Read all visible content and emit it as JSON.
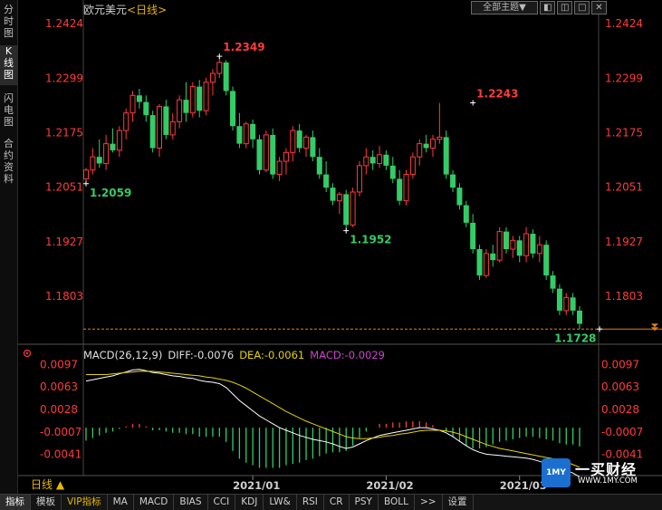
{
  "sidebar": {
    "tabs": [
      {
        "label": "分时图",
        "active": false
      },
      {
        "label": "K线图",
        "active": true
      },
      {
        "label": "闪电图",
        "active": false
      },
      {
        "label": "合约资料",
        "active": false
      }
    ]
  },
  "header": {
    "symbol": "欧元美元",
    "period": "<日线>",
    "view_dropdown": "全部主题▼",
    "buttons": [
      "◧",
      "◫",
      "□",
      "✕"
    ]
  },
  "period_selector": "日线 ▲",
  "macd_legend": {
    "name": "MACD(26,12,9)",
    "diff": "DIFF:-0.0076",
    "dea": "DEA:-0.0061",
    "macd": "MACD:-0.0029"
  },
  "colors": {
    "up": "#ff3b3b",
    "down": "#33cc66",
    "axis_label": "#ff3b3b",
    "diff_line": "#ffffff",
    "dea_line": "#e6d200",
    "macd_text": "#cc44cc"
  },
  "bottom_tabs": [
    {
      "label": "指标",
      "active": true
    },
    {
      "label": "模板"
    },
    {
      "label": "VIP指标",
      "vip": true
    },
    {
      "label": "MA"
    },
    {
      "label": "MACD"
    },
    {
      "label": "BIAS"
    },
    {
      "label": "CCI"
    },
    {
      "label": "KDJ"
    },
    {
      "label": "LW&"
    },
    {
      "label": "RSI"
    },
    {
      "label": "CR"
    },
    {
      "label": "PSY"
    },
    {
      "label": "BOLL"
    },
    {
      "label": ">>"
    },
    {
      "label": "设置"
    }
  ],
  "watermark": {
    "logo": "1MY",
    "name": "一买财经",
    "url": "WWW.1MY.COM"
  },
  "chart_data": [
    {
      "type": "candlestick",
      "ylim": [
        1.171,
        1.244
      ],
      "yticks": [
        1.2424,
        1.2299,
        1.2175,
        1.2051,
        1.1927,
        1.1803
      ],
      "ytick_labels": [
        "1.2424",
        "1.2299",
        "1.2175",
        "1.2051",
        "1.1927",
        "1.1803"
      ],
      "xticks": [
        {
          "index": 25,
          "label": "2021/01"
        },
        {
          "index": 45,
          "label": "2021/02"
        },
        {
          "index": 65,
          "label": "2021/03"
        }
      ],
      "annotations": [
        {
          "index": 20,
          "value": 1.2349,
          "label": "1.2349",
          "side": "high"
        },
        {
          "index": 0,
          "value": 1.2059,
          "label": "1.2059",
          "side": "low"
        },
        {
          "index": 39,
          "value": 1.1952,
          "label": "1.1952",
          "side": "low"
        },
        {
          "index": 58,
          "value": 1.2243,
          "label": "1.2243",
          "side": "high"
        },
        {
          "index": 77,
          "value": 1.1728,
          "label": "1.1728",
          "side": "low"
        }
      ],
      "last_price_line": 1.1728,
      "candles": [
        [
          1.207,
          1.2095,
          1.2059,
          1.209
        ],
        [
          1.209,
          1.214,
          1.208,
          1.212
        ],
        [
          1.212,
          1.216,
          1.2095,
          1.2105
        ],
        [
          1.2105,
          1.217,
          1.209,
          1.215
        ],
        [
          1.215,
          1.2185,
          1.213,
          1.2135
        ],
        [
          1.2135,
          1.219,
          1.212,
          1.218
        ],
        [
          1.218,
          1.223,
          1.216,
          1.222
        ],
        [
          1.222,
          1.227,
          1.22,
          1.226
        ],
        [
          1.226,
          1.2275,
          1.223,
          1.2245
        ],
        [
          1.2245,
          1.226,
          1.22,
          1.2215
        ],
        [
          1.2215,
          1.2225,
          1.213,
          1.214
        ],
        [
          1.214,
          1.224,
          1.212,
          1.2235
        ],
        [
          1.2235,
          1.225,
          1.216,
          1.217
        ],
        [
          1.217,
          1.222,
          1.216,
          1.22
        ],
        [
          1.22,
          1.226,
          1.2185,
          1.225
        ],
        [
          1.225,
          1.229,
          1.22,
          1.222
        ],
        [
          1.222,
          1.229,
          1.221,
          1.228
        ],
        [
          1.228,
          1.2295,
          1.221,
          1.2225
        ],
        [
          1.2225,
          1.23,
          1.2215,
          1.229
        ],
        [
          1.229,
          1.232,
          1.226,
          1.231
        ],
        [
          1.231,
          1.2349,
          1.23,
          1.2335
        ],
        [
          1.2335,
          1.234,
          1.226,
          1.227
        ],
        [
          1.227,
          1.228,
          1.218,
          1.219
        ],
        [
          1.219,
          1.222,
          1.214,
          1.215
        ],
        [
          1.215,
          1.22,
          1.214,
          1.2195
        ],
        [
          1.2195,
          1.2205,
          1.214,
          1.216
        ],
        [
          1.216,
          1.217,
          1.208,
          1.209
        ],
        [
          1.209,
          1.218,
          1.2085,
          1.217
        ],
        [
          1.217,
          1.2185,
          1.207,
          1.208
        ],
        [
          1.208,
          1.212,
          1.2065,
          1.211
        ],
        [
          1.211,
          1.214,
          1.208,
          1.213
        ],
        [
          1.213,
          1.219,
          1.211,
          1.218
        ],
        [
          1.218,
          1.2195,
          1.213,
          1.214
        ],
        [
          1.214,
          1.217,
          1.212,
          1.2165
        ],
        [
          1.2165,
          1.218,
          1.211,
          1.212
        ],
        [
          1.212,
          1.214,
          1.207,
          1.208
        ],
        [
          1.208,
          1.211,
          1.204,
          1.205
        ],
        [
          1.205,
          1.206,
          1.201,
          1.202
        ],
        [
          1.202,
          1.204,
          1.199,
          1.2035
        ],
        [
          1.2035,
          1.2045,
          1.1952,
          1.1965
        ],
        [
          1.1965,
          1.205,
          1.196,
          1.204
        ],
        [
          1.204,
          1.211,
          1.203,
          1.21
        ],
        [
          1.21,
          1.214,
          1.208,
          1.212
        ],
        [
          1.212,
          1.2135,
          1.209,
          1.2105
        ],
        [
          1.2105,
          1.2145,
          1.2095,
          1.2125
        ],
        [
          1.2125,
          1.2135,
          1.209,
          1.21
        ],
        [
          1.21,
          1.212,
          1.206,
          1.207
        ],
        [
          1.207,
          1.209,
          1.201,
          1.202
        ],
        [
          1.202,
          1.209,
          1.201,
          1.208
        ],
        [
          1.208,
          1.213,
          1.207,
          1.212
        ],
        [
          1.212,
          1.216,
          1.21,
          1.215
        ],
        [
          1.215,
          1.217,
          1.213,
          1.214
        ],
        [
          1.214,
          1.217,
          1.212,
          1.216
        ],
        [
          1.216,
          1.2243,
          1.215,
          1.2165
        ],
        [
          1.2165,
          1.218,
          1.207,
          1.208
        ],
        [
          1.208,
          1.209,
          1.204,
          1.205
        ],
        [
          1.205,
          1.206,
          1.2,
          1.201
        ],
        [
          1.201,
          1.202,
          1.196,
          1.197
        ],
        [
          1.197,
          1.199,
          1.19,
          1.191
        ],
        [
          1.191,
          1.192,
          1.184,
          1.185
        ],
        [
          1.185,
          1.191,
          1.1845,
          1.19
        ],
        [
          1.19,
          1.192,
          1.187,
          1.1885
        ],
        [
          1.1885,
          1.196,
          1.188,
          1.195
        ],
        [
          1.195,
          1.196,
          1.19,
          1.191
        ],
        [
          1.191,
          1.194,
          1.189,
          1.193
        ],
        [
          1.193,
          1.194,
          1.188,
          1.1895
        ],
        [
          1.1895,
          1.196,
          1.188,
          1.1945
        ],
        [
          1.1945,
          1.1955,
          1.189,
          1.19
        ],
        [
          1.19,
          1.194,
          1.188,
          1.192
        ],
        [
          1.192,
          1.193,
          1.184,
          1.185
        ],
        [
          1.185,
          1.186,
          1.181,
          1.182
        ],
        [
          1.182,
          1.183,
          1.176,
          1.177
        ],
        [
          1.177,
          1.181,
          1.176,
          1.18
        ],
        [
          1.18,
          1.181,
          1.176,
          1.177
        ],
        [
          1.177,
          1.178,
          1.1728,
          1.174
        ]
      ]
    },
    {
      "type": "line",
      "name": "MACD",
      "ylim": [
        -0.006,
        0.0112
      ],
      "yticks": [
        0.0097,
        0.0063,
        0.0028,
        -0.0007,
        -0.0041
      ],
      "ytick_labels": [
        "0.0097",
        "0.0063",
        "0.0028",
        "-0.0007",
        "-0.0041"
      ],
      "series": [
        {
          "name": "DIFF",
          "values": [
            0.0072,
            0.0074,
            0.0076,
            0.0078,
            0.008,
            0.0083,
            0.0086,
            0.0089,
            0.009,
            0.0088,
            0.0085,
            0.0084,
            0.0082,
            0.008,
            0.0079,
            0.0077,
            0.0076,
            0.0073,
            0.0071,
            0.007,
            0.0068,
            0.0062,
            0.0052,
            0.0042,
            0.0034,
            0.0026,
            0.0018,
            0.0012,
            0.0006,
            0.0,
            -0.0004,
            -0.0008,
            -0.0012,
            -0.0015,
            -0.0018,
            -0.002,
            -0.0022,
            -0.0025,
            -0.0029,
            -0.0032,
            -0.003,
            -0.0025,
            -0.002,
            -0.0016,
            -0.0012,
            -0.001,
            -0.0008,
            -0.0006,
            -0.0004,
            -0.0002,
            0.0,
            0.0,
            -0.0002,
            -0.0004,
            -0.0008,
            -0.0014,
            -0.0021,
            -0.0028,
            -0.0034,
            -0.0038,
            -0.0041,
            -0.0042,
            -0.0043,
            -0.0044,
            -0.0045,
            -0.0046,
            -0.0047,
            -0.0049,
            -0.0052,
            -0.0055,
            -0.0058,
            -0.0062,
            -0.0066,
            -0.007,
            -0.0076
          ]
        },
        {
          "name": "DEA",
          "values": [
            0.0082,
            0.0082,
            0.0082,
            0.0082,
            0.0083,
            0.0084,
            0.0085,
            0.0086,
            0.0087,
            0.0087,
            0.0087,
            0.0086,
            0.0085,
            0.0084,
            0.0083,
            0.0082,
            0.0081,
            0.008,
            0.0078,
            0.0077,
            0.0075,
            0.0073,
            0.007,
            0.0066,
            0.0061,
            0.0055,
            0.0049,
            0.0043,
            0.0037,
            0.0031,
            0.0025,
            0.002,
            0.0015,
            0.001,
            0.0006,
            0.0002,
            -0.0002,
            -0.0006,
            -0.001,
            -0.0014,
            -0.0016,
            -0.0017,
            -0.0017,
            -0.0016,
            -0.0015,
            -0.0013,
            -0.0012,
            -0.001,
            -0.0009,
            -0.0007,
            -0.0005,
            -0.0004,
            -0.0004,
            -0.0004,
            -0.0005,
            -0.0007,
            -0.001,
            -0.0014,
            -0.0018,
            -0.0022,
            -0.0026,
            -0.0029,
            -0.0032,
            -0.0034,
            -0.0036,
            -0.0038,
            -0.004,
            -0.0042,
            -0.0044,
            -0.0046,
            -0.0048,
            -0.005,
            -0.0053,
            -0.0057,
            -0.0061
          ]
        },
        {
          "name": "MACD",
          "values": [
            -0.002,
            -0.0016,
            -0.0012,
            -0.0008,
            -0.0006,
            -0.0002,
            0.0002,
            0.0006,
            0.0006,
            0.0002,
            -0.0004,
            -0.0004,
            -0.0006,
            -0.0008,
            -0.0008,
            -0.001,
            -0.001,
            -0.0014,
            -0.0014,
            -0.0014,
            -0.0014,
            -0.0022,
            -0.0036,
            -0.0048,
            -0.0054,
            -0.0058,
            -0.0062,
            -0.0062,
            -0.0062,
            -0.0062,
            -0.0058,
            -0.0056,
            -0.0054,
            -0.005,
            -0.0048,
            -0.0044,
            -0.004,
            -0.0038,
            -0.0038,
            -0.0036,
            -0.0028,
            -0.0016,
            -0.0006,
            0.0,
            0.0006,
            0.0006,
            0.0008,
            0.0008,
            0.001,
            0.001,
            0.001,
            0.0008,
            0.0004,
            0.0,
            -0.0006,
            -0.0014,
            -0.0022,
            -0.0028,
            -0.0032,
            -0.0032,
            -0.003,
            -0.0026,
            -0.0022,
            -0.002,
            -0.0018,
            -0.0016,
            -0.0014,
            -0.0014,
            -0.0016,
            -0.0018,
            -0.002,
            -0.0024,
            -0.0026,
            -0.0026,
            -0.0029
          ]
        }
      ]
    }
  ]
}
